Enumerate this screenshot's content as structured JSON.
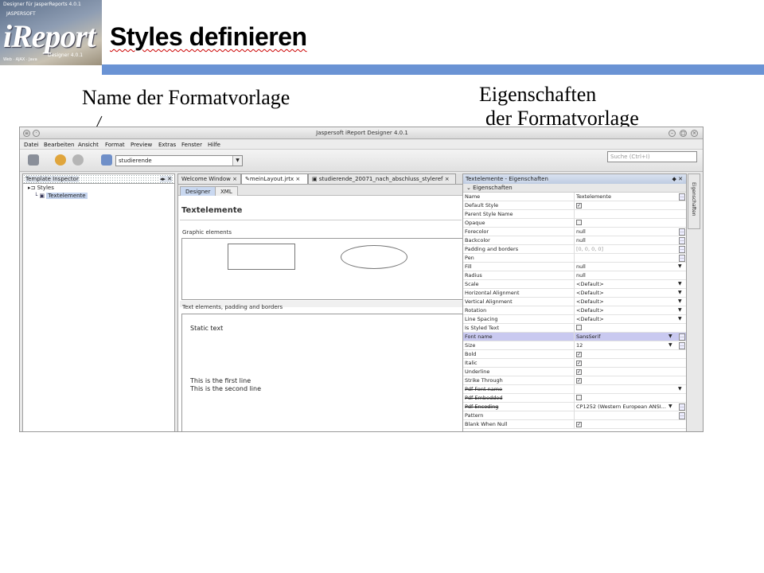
{
  "logo": {
    "line1": "Designer für JasperReports 4.0.1",
    "line2": "JASPERSOFT",
    "brand": "iReport",
    "line3": "Designer 4.0.1",
    "line4": "Web · AJAX · Java"
  },
  "slide_title": "Styles definieren",
  "captions": {
    "left": "Name der Formatvorlage",
    "right_line1": "Eigenschaften",
    "right_line2": "der Formatvorlage"
  },
  "app": {
    "window_title": "Jaspersoft iReport Designer 4.0.1",
    "menu": [
      "Datei",
      "Bearbeiten",
      "Ansicht",
      "Format",
      "Preview",
      "Extras",
      "Fenster",
      "Hilfe"
    ],
    "datasource": "studierende",
    "search_placeholder": "Suche (Ctrl+I)",
    "inspector_title": "Template Inspector",
    "tree_root": "Styles",
    "tree_child": "Textelemente",
    "tabs": [
      "Welcome Window",
      "meinLayout.jrtx",
      "studierende_20071_nach_abschluss_styleref"
    ],
    "subtabs": [
      "Designer",
      "XML"
    ],
    "editor_heading": "Textelemente",
    "section1": "Graphic elements",
    "section2": "Text elements, padding and borders",
    "static_text": "Static text",
    "line_a": "This is the first line",
    "line_b": "This is the second line",
    "props_title": "Textelemente - Eigenschaften",
    "props_group": "Eigenschaften",
    "side_tab": "Eigenschaften"
  },
  "properties": [
    {
      "name": "Name",
      "value": "Textelemente",
      "kind": "text",
      "btn": true
    },
    {
      "name": "Default Style",
      "value": "",
      "kind": "check",
      "checked": true
    },
    {
      "name": "Parent Style Name",
      "value": "",
      "kind": "text"
    },
    {
      "name": "Opaque",
      "value": "",
      "kind": "check",
      "checked": false
    },
    {
      "name": "Forecolor",
      "value": "null",
      "kind": "text",
      "btn": true
    },
    {
      "name": "Backcolor",
      "value": "null",
      "kind": "text",
      "btn": true
    },
    {
      "name": "Padding and borders",
      "value": "[0, 0, 0, 0]",
      "kind": "text",
      "btn": true
    },
    {
      "name": "Pen",
      "value": "",
      "kind": "line",
      "btn": true
    },
    {
      "name": "Fill",
      "value": "null",
      "kind": "dropdown"
    },
    {
      "name": "Radius",
      "value": "null",
      "kind": "text"
    },
    {
      "name": "Scale",
      "value": "<Default>",
      "kind": "dropdown"
    },
    {
      "name": "Horizontal Alignment",
      "value": "<Default>",
      "kind": "dropdown"
    },
    {
      "name": "Vertical Alignment",
      "value": "<Default>",
      "kind": "dropdown"
    },
    {
      "name": "Rotation",
      "value": "<Default>",
      "kind": "dropdown"
    },
    {
      "name": "Line Spacing",
      "value": "<Default>",
      "kind": "dropdown"
    },
    {
      "name": "Is Styled Text",
      "value": "",
      "kind": "check",
      "checked": false
    },
    {
      "name": "Font name",
      "value": "SansSerif",
      "kind": "dropdown",
      "btn": true,
      "highlight": true
    },
    {
      "name": "Size",
      "value": "12",
      "kind": "dropdown",
      "btn": true
    },
    {
      "name": "Bold",
      "value": "",
      "kind": "check",
      "checked": true
    },
    {
      "name": "Italic",
      "value": "",
      "kind": "check",
      "checked": true
    },
    {
      "name": "Underline",
      "value": "",
      "kind": "check",
      "checked": true
    },
    {
      "name": "Strike Through",
      "value": "",
      "kind": "check",
      "checked": true
    },
    {
      "name": "Pdf Font name",
      "value": "",
      "kind": "dropdown",
      "strike": true
    },
    {
      "name": "Pdf Embedded",
      "value": "",
      "kind": "check",
      "checked": false,
      "strike": true
    },
    {
      "name": "Pdf Encoding",
      "value": "CP1252 (Western European ANSI...",
      "kind": "dropdown",
      "btn": true,
      "strike": true
    },
    {
      "name": "Pattern",
      "value": "",
      "kind": "text",
      "btn": true
    },
    {
      "name": "Blank When Null",
      "value": "",
      "kind": "check",
      "checked": true
    }
  ]
}
